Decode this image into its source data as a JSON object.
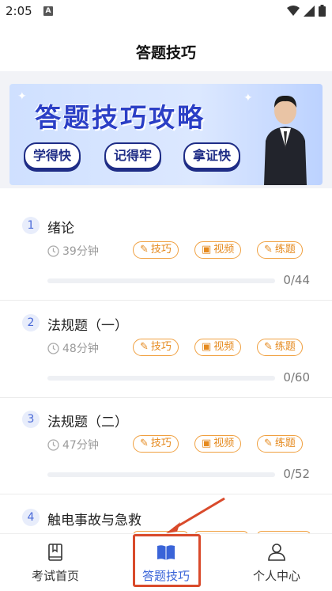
{
  "status_bar": {
    "time": "2:05",
    "notif_badge": "A"
  },
  "header": {
    "title": "答题技巧"
  },
  "banner": {
    "title": "答题技巧攻略",
    "pills": [
      "学得快",
      "记得牢",
      "拿证快"
    ]
  },
  "lessons": [
    {
      "num": "1",
      "title": "绪论",
      "duration": "39分钟",
      "progress": "0/44",
      "progress_fraction": 0
    },
    {
      "num": "2",
      "title": "法规题（一）",
      "duration": "48分钟",
      "progress": "0/60",
      "progress_fraction": 0
    },
    {
      "num": "3",
      "title": "法规题（二）",
      "duration": "47分钟",
      "progress": "0/52",
      "progress_fraction": 0
    },
    {
      "num": "4",
      "title": "触电事故与急救"
    }
  ],
  "tags": {
    "skill": "技巧",
    "video": "视频",
    "practice": "练题"
  },
  "nav": [
    {
      "label": "考试首页",
      "icon": "book-icon"
    },
    {
      "label": "答题技巧",
      "icon": "open-book-icon",
      "active": true
    },
    {
      "label": "个人中心",
      "icon": "person-icon"
    }
  ],
  "colors": {
    "accent": "#3a64d8",
    "tag_orange": "#e58a1f",
    "highlight_red": "#d94a2b"
  }
}
